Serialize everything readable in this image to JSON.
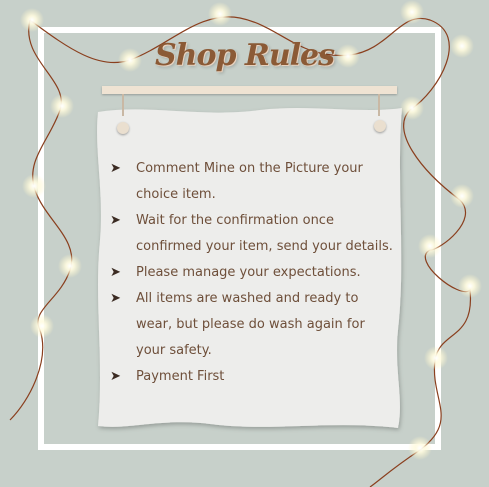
{
  "title": "Shop Rules",
  "rules": [
    "Comment Mine on the Picture your choice item.",
    "Wait for the confirmation once confirmed your item, send your details.",
    "Please manage your expectations.",
    "All items are washed and ready to wear, but please do wash again for your safety.",
    "Payment First"
  ],
  "bullet_icon": "arrow-bullet-icon",
  "colors": {
    "background": "#c7d0ca",
    "frame": "#ffffff",
    "paper": "#ededeb",
    "title": "#8b5a36",
    "text": "#6e4f3a",
    "string_lights_wire": "#8a3f1e",
    "bulb_glow": "#fffbe0"
  }
}
